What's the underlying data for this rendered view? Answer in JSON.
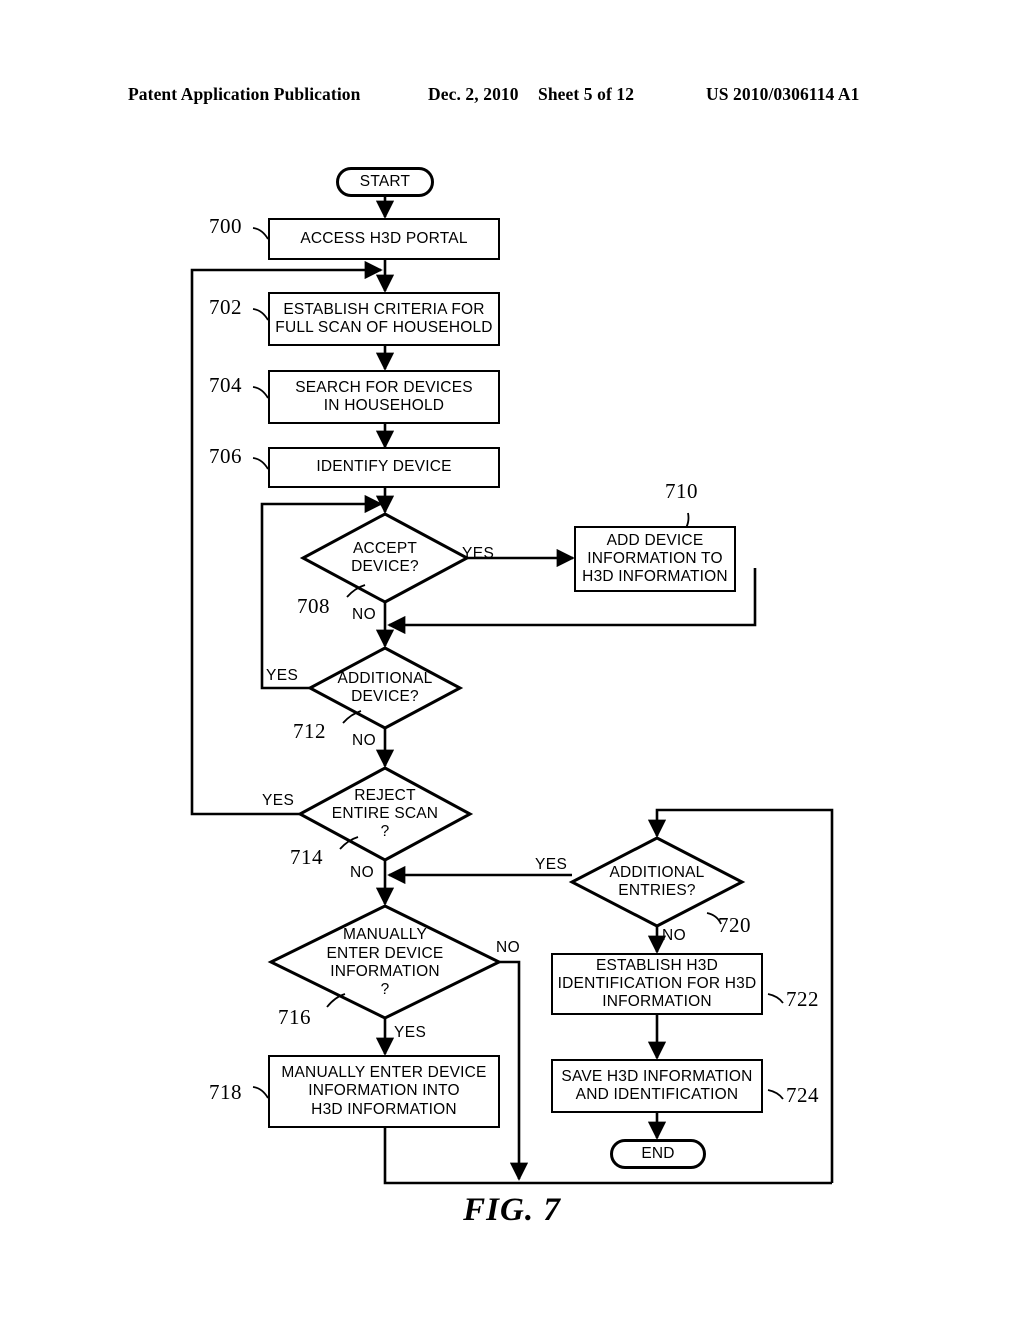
{
  "header": {
    "publication": "Patent Application Publication",
    "date": "Dec. 2, 2010",
    "sheet": "Sheet 5 of 12",
    "patent_number": "US 2010/0306114 A1"
  },
  "caption": "FIG. 7",
  "colors": {
    "line": "#000000",
    "background": "#ffffff"
  },
  "flowchart": {
    "title": "FIG. 7",
    "nodes": [
      {
        "id": "start",
        "ref": "",
        "type": "terminator",
        "text": "START"
      },
      {
        "id": "n700",
        "ref": "700",
        "type": "process",
        "text": "ACCESS H3D PORTAL"
      },
      {
        "id": "n702",
        "ref": "702",
        "type": "process",
        "text": "ESTABLISH CRITERIA FOR\nFULL SCAN OF HOUSEHOLD"
      },
      {
        "id": "n704",
        "ref": "704",
        "type": "process",
        "text": "SEARCH FOR DEVICES\nIN HOUSEHOLD"
      },
      {
        "id": "n706",
        "ref": "706",
        "type": "process",
        "text": "IDENTIFY DEVICE"
      },
      {
        "id": "n708",
        "ref": "708",
        "type": "decision",
        "text": "ACCEPT\nDEVICE?"
      },
      {
        "id": "n710",
        "ref": "710",
        "type": "process",
        "text": "ADD DEVICE\nINFORMATION TO\nH3D INFORMATION"
      },
      {
        "id": "n712",
        "ref": "712",
        "type": "decision",
        "text": "ADDITIONAL\nDEVICE?"
      },
      {
        "id": "n714",
        "ref": "714",
        "type": "decision",
        "text": "REJECT\nENTIRE  SCAN\n?"
      },
      {
        "id": "n716",
        "ref": "716",
        "type": "decision",
        "text": "MANUALLY\nENTER DEVICE\nINFORMATION\n?"
      },
      {
        "id": "n718",
        "ref": "718",
        "type": "process",
        "text": "MANUALLY ENTER DEVICE\nINFORMATION INTO\nH3D INFORMATION"
      },
      {
        "id": "n720",
        "ref": "720",
        "type": "decision",
        "text": "ADDITIONAL\nENTRIES?"
      },
      {
        "id": "n722",
        "ref": "722",
        "type": "process",
        "text": "ESTABLISH H3D\nIDENTIFICATION FOR H3D\nINFORMATION"
      },
      {
        "id": "n724",
        "ref": "724",
        "type": "process",
        "text": "SAVE H3D INFORMATION\nAND IDENTIFICATION"
      },
      {
        "id": "end",
        "ref": "",
        "type": "terminator",
        "text": "END"
      }
    ],
    "edge_labels": [
      {
        "id": "e708-yes",
        "text": "YES",
        "from": "n708"
      },
      {
        "id": "e708-no",
        "text": "NO",
        "from": "n708"
      },
      {
        "id": "e712-yes",
        "text": "YES",
        "from": "n712"
      },
      {
        "id": "e712-no",
        "text": "NO",
        "from": "n712"
      },
      {
        "id": "e714-yes",
        "text": "YES",
        "from": "n714"
      },
      {
        "id": "e714-no",
        "text": "NO",
        "from": "n714"
      },
      {
        "id": "e716-yes",
        "text": "YES",
        "from": "n716"
      },
      {
        "id": "e716-no",
        "text": "NO",
        "from": "n716"
      },
      {
        "id": "e720-yes",
        "text": "YES",
        "from": "n720"
      },
      {
        "id": "e720-no",
        "text": "NO",
        "from": "n720"
      }
    ],
    "edges": [
      {
        "from": "start",
        "to": "n700",
        "label": ""
      },
      {
        "from": "n700",
        "to": "n702",
        "label": ""
      },
      {
        "from": "n702",
        "to": "n704",
        "label": ""
      },
      {
        "from": "n704",
        "to": "n706",
        "label": ""
      },
      {
        "from": "n706",
        "to": "n708",
        "label": ""
      },
      {
        "from": "n708",
        "to": "n710",
        "label": "YES"
      },
      {
        "from": "n708",
        "to": "n712",
        "label": "NO"
      },
      {
        "from": "n710",
        "to": "n712",
        "label": ""
      },
      {
        "from": "n712",
        "to": "n708",
        "label": "YES"
      },
      {
        "from": "n712",
        "to": "n714",
        "label": "NO"
      },
      {
        "from": "n714",
        "to": "n702",
        "label": "YES"
      },
      {
        "from": "n714",
        "to": "n716",
        "label": "NO"
      },
      {
        "from": "n716",
        "to": "n718",
        "label": "YES"
      },
      {
        "from": "n716",
        "to": "n720",
        "label": "NO"
      },
      {
        "from": "n718",
        "to": "n720",
        "label": ""
      },
      {
        "from": "n720",
        "to": "n716",
        "label": "YES"
      },
      {
        "from": "n720",
        "to": "n722",
        "label": "NO"
      },
      {
        "from": "n722",
        "to": "n724",
        "label": ""
      },
      {
        "from": "n724",
        "to": "end",
        "label": ""
      }
    ]
  }
}
